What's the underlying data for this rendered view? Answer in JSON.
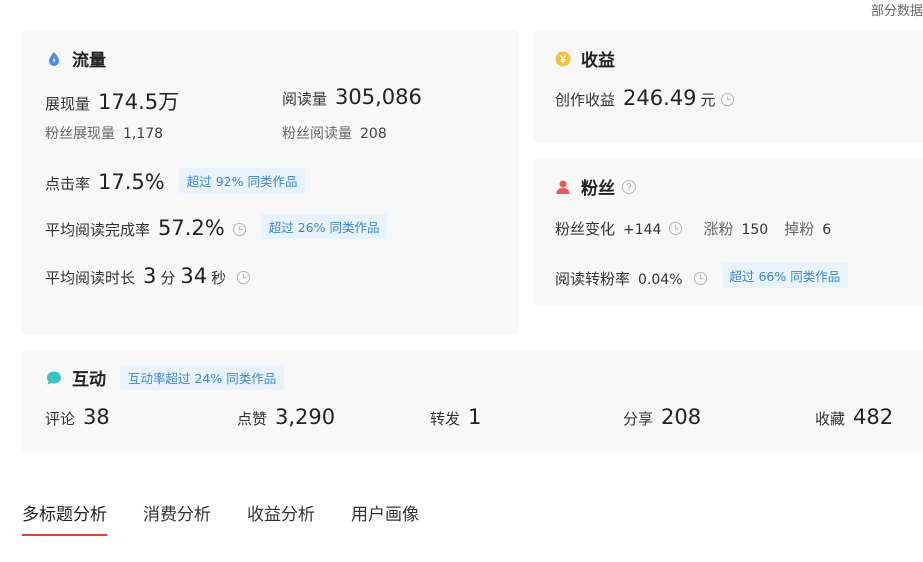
{
  "corner_note": "部分数据",
  "traffic": {
    "title": "流量",
    "impressions": {
      "label": "展现量",
      "value": "174.5万"
    },
    "reads": {
      "label": "阅读量",
      "value": "305,086"
    },
    "fan_impressions": {
      "label": "粉丝展现量",
      "value": "1,178"
    },
    "fan_reads": {
      "label": "粉丝阅读量",
      "value": "208"
    },
    "ctr": {
      "label": "点击率",
      "value": "17.5%",
      "badge": "超过 92% 同类作品"
    },
    "completion": {
      "label": "平均阅读完成率",
      "value": "57.2%",
      "badge": "超过 26% 同类作品"
    },
    "duration": {
      "label": "平均阅读时长",
      "minutes": "3",
      "min_unit": "分",
      "seconds": "34",
      "sec_unit": "秒"
    }
  },
  "income": {
    "title": "收益",
    "label": "创作收益",
    "value": "246.49",
    "unit": "元"
  },
  "fans": {
    "title": "粉丝",
    "change": {
      "label": "粉丝变化",
      "value": "+144"
    },
    "gain": {
      "label": "涨粉",
      "value": "150"
    },
    "loss": {
      "label": "掉粉",
      "value": "6"
    },
    "conversion": {
      "label": "阅读转粉率",
      "value": "0.04%",
      "badge": "超过 66% 同类作品"
    }
  },
  "interaction": {
    "title": "互动",
    "badge": "互动率超过 24% 同类作品",
    "items": [
      {
        "label": "评论",
        "value": "38"
      },
      {
        "label": "点赞",
        "value": "3,290"
      },
      {
        "label": "转发",
        "value": "1"
      },
      {
        "label": "分享",
        "value": "208"
      },
      {
        "label": "收藏",
        "value": "482"
      }
    ]
  },
  "tabs": [
    {
      "label": "多标题分析",
      "active": true
    },
    {
      "label": "消费分析",
      "active": false
    },
    {
      "label": "收益分析",
      "active": false
    },
    {
      "label": "用户画像",
      "active": false
    }
  ],
  "colors": {
    "accent": "#e03c3c",
    "badge_bg": "#e8f3ff",
    "badge_text": "#3a86d6",
    "traffic_icon": "#4a8df0",
    "income_icon": "#f5c242",
    "fans_icon": "#e85a5a",
    "interaction_icon": "#3cc4c4"
  }
}
